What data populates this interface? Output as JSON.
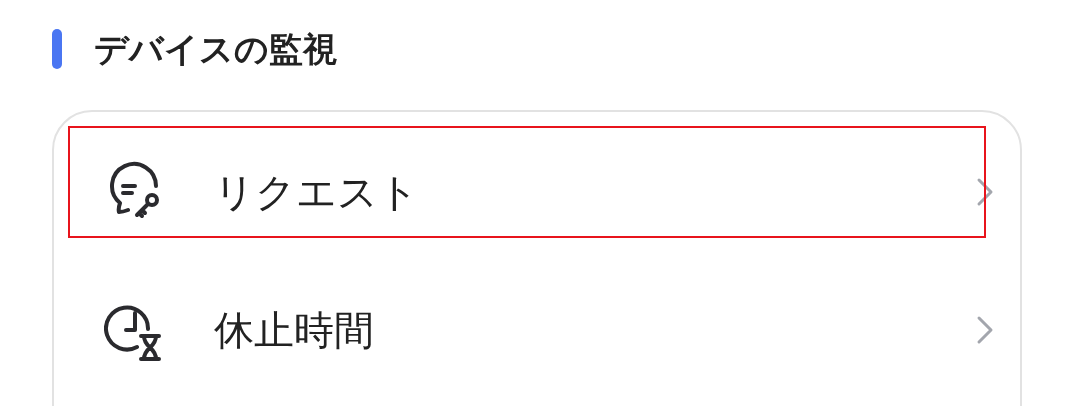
{
  "section": {
    "title": "デバイスの監視"
  },
  "items": [
    {
      "label": "リクエスト",
      "highlighted": true
    },
    {
      "label": "休止時間",
      "highlighted": false
    }
  ]
}
